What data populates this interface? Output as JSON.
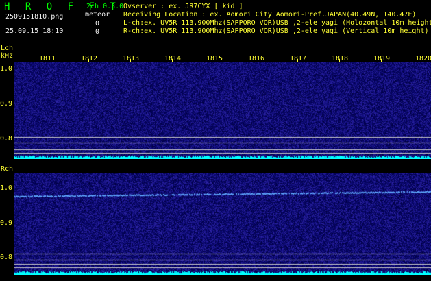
{
  "header": {
    "app_title": "H R O F F T",
    "mode": "2ch 0.3.0",
    "filename": "2509151810.png",
    "datetime": "25.09.15 18:10",
    "meteor_label": "meteor",
    "meteor_count_l": "0",
    "meteor_count_r": "0",
    "observer_line": "Ovserver            : ex. JR7CYX [ kid ]",
    "location_line": "Receiving Location : ex. Aomori City Aomori-Pref.JAPAN(40.49N, 140.47E)",
    "lch_line": "L-ch:ex. UV5R 113.900Mhz(SAPPORO VOR)USB ,2-ele yagi (Holozontal 10m height",
    "rch_line": "R-ch:ex. UV5R 113.900Mhz(SAPPORO VOR)USB ,2-ele yagi (Vertical 10m height)"
  },
  "lch": {
    "label": "Lch",
    "unit": "kHz",
    "yticks": [
      "1.0",
      "0.9",
      "0.8"
    ]
  },
  "rch": {
    "label": "Rch",
    "yticks": [
      "1.0",
      "0.9",
      "0.8"
    ]
  },
  "time_axis": {
    "labels": [
      "1811",
      "1812",
      "1813",
      "1814",
      "1815",
      "1816",
      "1817",
      "1818",
      "1819",
      "1820"
    ]
  },
  "colors": {
    "background": "#000000",
    "waterfall": "#0a0a5a",
    "signal": "#5fa8ff",
    "level": "#00ffff",
    "text_green": "#00ff00",
    "text_yellow": "#ffff33"
  }
}
